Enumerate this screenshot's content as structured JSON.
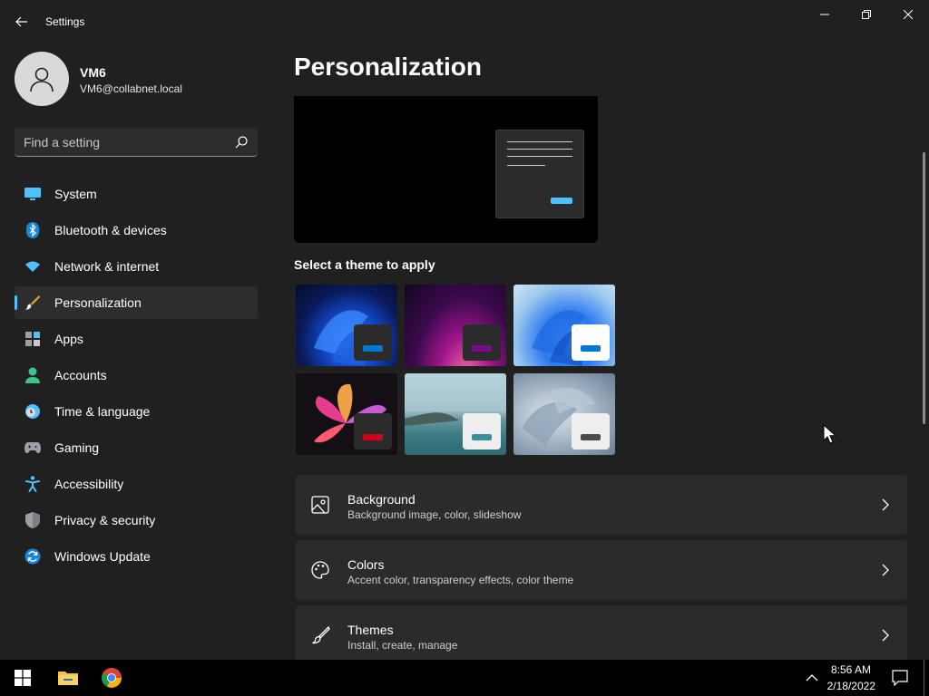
{
  "window": {
    "title": "Settings"
  },
  "user": {
    "name": "VM6",
    "email": "VM6@collabnet.local"
  },
  "search": {
    "placeholder": "Find a setting"
  },
  "sidebar": {
    "items": [
      {
        "label": "System",
        "icon": "monitor-icon",
        "selected": false
      },
      {
        "label": "Bluetooth & devices",
        "icon": "bluetooth-icon",
        "selected": false
      },
      {
        "label": "Network & internet",
        "icon": "wifi-icon",
        "selected": false
      },
      {
        "label": "Personalization",
        "icon": "paintbrush-icon",
        "selected": true
      },
      {
        "label": "Apps",
        "icon": "apps-icon",
        "selected": false
      },
      {
        "label": "Accounts",
        "icon": "person-icon",
        "selected": false
      },
      {
        "label": "Time & language",
        "icon": "clock-globe-icon",
        "selected": false
      },
      {
        "label": "Gaming",
        "icon": "gamepad-icon",
        "selected": false
      },
      {
        "label": "Accessibility",
        "icon": "accessibility-icon",
        "selected": false
      },
      {
        "label": "Privacy & security",
        "icon": "shield-icon",
        "selected": false
      },
      {
        "label": "Windows Update",
        "icon": "update-icon",
        "selected": false
      }
    ]
  },
  "main": {
    "title": "Personalization",
    "themes_heading": "Select a theme to apply",
    "themes": [
      {
        "name": "windows-dark",
        "accent": "#0078d4",
        "mini": "#2b2b2b"
      },
      {
        "name": "glow",
        "accent": "#7a0a8c",
        "mini": "#2b2b2b"
      },
      {
        "name": "windows-light",
        "accent": "#0078d4",
        "mini": "#ffffff"
      },
      {
        "name": "captured-motion",
        "accent": "#d0021b",
        "mini": "#2b2b2b"
      },
      {
        "name": "sunrise",
        "accent": "#3a8f9a",
        "mini": "#eeeeee"
      },
      {
        "name": "flow",
        "accent": "#4a4a4a",
        "mini": "#eeeeee"
      }
    ],
    "cards": [
      {
        "title": "Background",
        "subtitle": "Background image, color, slideshow",
        "icon": "image-icon"
      },
      {
        "title": "Colors",
        "subtitle": "Accent color, transparency effects, color theme",
        "icon": "palette-icon"
      },
      {
        "title": "Themes",
        "subtitle": "Install, create, manage",
        "icon": "brush-icon"
      }
    ]
  },
  "taskbar": {
    "time": "8:56 AM",
    "date": "2/18/2022"
  },
  "colors": {
    "accent": "#4cc2ff",
    "background": "#202020",
    "card": "#2b2b2b"
  }
}
